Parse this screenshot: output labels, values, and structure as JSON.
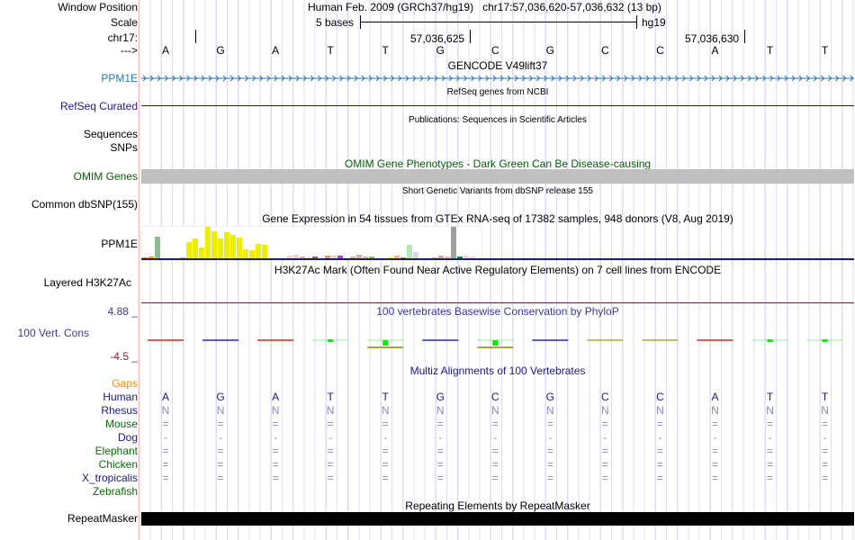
{
  "header": {
    "window_position_label": "Window Position",
    "window_position_text": "Human Feb. 2009 (GRCh37/hg19)   chr17:57,036,620-57,036,632 (13 bp)",
    "scale_label": "Scale",
    "scale_text": "5 bases",
    "scale_assembly": "hg19",
    "chrom_label": "chr17:",
    "coord_1": "57,036,625",
    "coord_2": "57,036,630",
    "strand_label": "--->",
    "bases": [
      "A",
      "G",
      "A",
      "T",
      "T",
      "G",
      "C",
      "G",
      "C",
      "C",
      "A",
      "T",
      "T"
    ]
  },
  "tracks": {
    "gencode": {
      "title": "GENCODE V49lift37",
      "label": "PPM1E",
      "color": "#2078c0"
    },
    "refseq": {
      "title": "RefSeq genes from NCBI",
      "label": "RefSeq Curated",
      "color": "#1a1a80"
    },
    "publications": {
      "title": "Publications: Sequences in Scientific Articles",
      "label_1": "Sequences",
      "label_2": "SNPs"
    },
    "omim": {
      "title": "OMIM Gene Phenotypes - Dark Green Can Be Disease-causing",
      "label": "OMIM Genes",
      "color": "#0a5c0a",
      "bar_color": "#c0c0c0"
    },
    "dbsnp": {
      "title": "Short Genetic Variants from dbSNP release 155",
      "label": "Common dbSNP(155)"
    },
    "gtex": {
      "title": "Gene Expression in 54 tissues from GTEx RNA-seq of 17382 samples, 948 donors (V8, Aug 2019)",
      "label": "PPM1E",
      "values": [
        2,
        3,
        25,
        0,
        1,
        1,
        2,
        19,
        23,
        13,
        36,
        31,
        23,
        30,
        27,
        24,
        11,
        10,
        17,
        16,
        1,
        1,
        1,
        4,
        5,
        3,
        2,
        3,
        1,
        4,
        4,
        4,
        1,
        3,
        5,
        3,
        3,
        1,
        1,
        2,
        4,
        2,
        16,
        8,
        1,
        1,
        2,
        4,
        3,
        36,
        3,
        4,
        3,
        1
      ],
      "colors": [
        "#f08030",
        "#f09010",
        "#8fbc8f",
        "#fff",
        "#f03030",
        "#f03030",
        "#d2b48c",
        "#eeee00",
        "#eeee00",
        "#eeee00",
        "#eeee00",
        "#eeee00",
        "#eeee00",
        "#eeee00",
        "#eeee00",
        "#eeee00",
        "#eeee00",
        "#eeee00",
        "#eeee00",
        "#eeee00",
        "#00cccc",
        "#ee66ee",
        "#99ccee",
        "#f0d0d0",
        "#f0d0d0",
        "#d2b48c",
        "#e8c89a",
        "#8b6b4a",
        "#8b6b4a",
        "#c8a070",
        "#f0d0d0",
        "#aa44cc",
        "#aa44cc",
        "#d2b48c",
        "#d2b48c",
        "#d2b48c",
        "#88cc22",
        "#d2b48c",
        "#f0f0f0",
        "#eeee00",
        "#ffaaaa",
        "#bb8833",
        "#b4e8b4",
        "#d8d8d8",
        "#3366ff",
        "#3388ee",
        "#d2b48c",
        "#d2b48c",
        "#f0c080",
        "#a0a0a0",
        "#008844",
        "#f0d0d0",
        "#f0d0d0",
        "#f0f0f0"
      ]
    },
    "h3k27ac": {
      "title": "H3K27Ac Mark (Often Found Near Active Regulatory Elements) on 7 cell lines from ENCODE",
      "label": "Layered H3K27Ac"
    },
    "phylop": {
      "title": "100 vertebrates Basewise Conservation by PhyloP",
      "label": "100 Vert. Cons",
      "max_label": "4.88 _",
      "min_label": "-4.5 _",
      "color": "#3a3a98",
      "segment_colors": [
        "#e03030",
        "#3030e0",
        "#e03030",
        "#33ee33",
        "#33ee33",
        "#3030e0",
        "#33ee33",
        "#3030e0",
        "#b0b040",
        "#b0b040",
        "#e03030",
        "#33ee33",
        "#33ee33"
      ]
    },
    "multiz": {
      "title": "Multiz Alignments of 100 Vertebrates",
      "gaps_label": "Gaps",
      "gaps_color": "#e88a00",
      "species": [
        {
          "name": "Human",
          "color": "#1a1a80",
          "seq": "AGATTGCGCCATT",
          "seq_color": "#1a1a80"
        },
        {
          "name": "Rhesus",
          "color": "#1a1a80",
          "seq": "NNNNNNNNNNNNN",
          "seq_color": "#8888bb"
        },
        {
          "name": "Mouse",
          "color": "#0a6a0a",
          "seq": "=============",
          "seq_color": "#8888bb"
        },
        {
          "name": "Dog",
          "color": "#1a1a80",
          "seq": "-------------",
          "seq_color": "#8888bb"
        },
        {
          "name": "Elephant",
          "color": "#0a6a0a",
          "seq": "=============",
          "seq_color": "#8888bb"
        },
        {
          "name": "Chicken",
          "color": "#0a6a0a",
          "seq": "=============",
          "seq_color": "#8888bb"
        },
        {
          "name": "X_tropicalis",
          "color": "#1a1a80",
          "seq": "=============",
          "seq_color": "#8888bb"
        },
        {
          "name": "Zebrafish",
          "color": "#0a6a0a",
          "seq": "",
          "seq_color": "#8888bb"
        }
      ]
    },
    "repeatmasker": {
      "title": "Repeating Elements by RepeatMasker",
      "label": "RepeatMasker"
    }
  }
}
